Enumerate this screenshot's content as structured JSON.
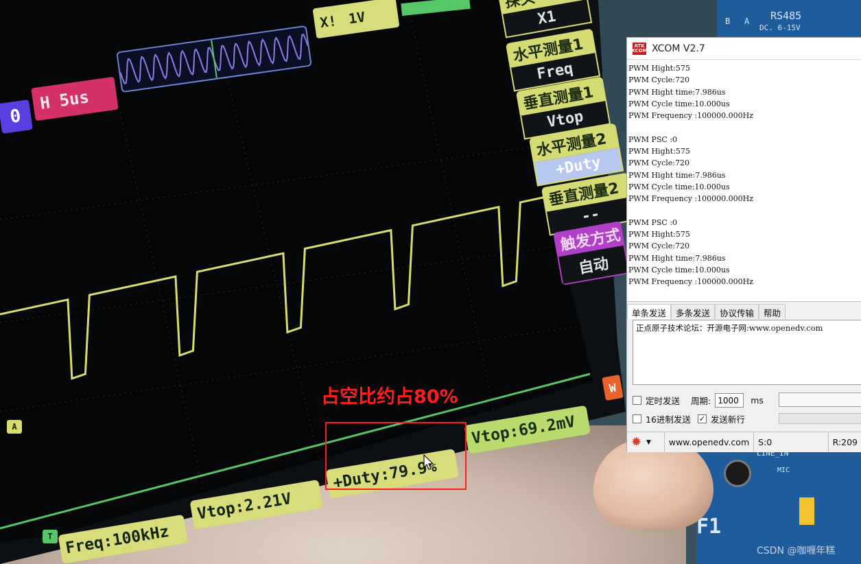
{
  "scope": {
    "timebase": {
      "channel_badge": "0",
      "h_label": "H",
      "h_value": "5us"
    },
    "probe": {
      "x_label": "X!",
      "x_value": "1V"
    },
    "side_menu": [
      {
        "label": "探头",
        "value": "X1"
      },
      {
        "label": "水平测量1",
        "value": "Freq"
      },
      {
        "label": "垂直测量1",
        "value": "Vtop"
      },
      {
        "label": "水平测量2",
        "value": "+Duty"
      },
      {
        "label": "垂直测量2",
        "value": "--"
      },
      {
        "label": "触发方式",
        "value": "自动"
      }
    ],
    "trigger_marker": "A",
    "time_marker": "T",
    "right_edge_badge": "W",
    "measurements": {
      "freq": "Freq:100kHz",
      "vtop1": "Vtop:2.21V",
      "duty": "+Duty:79.9%",
      "vtop2": "Vtop:69.2mV"
    },
    "waveform_duty_percent": 79.9,
    "waveform_color": "#d9dc6e",
    "reference_color": "#8c7de8"
  },
  "annotation": {
    "text": "占空比约占80%",
    "color": "#ff1d1d"
  },
  "board": {
    "rs485_label": "RS485",
    "voltage_label": "DC. 6-15V",
    "pin_a": "A",
    "pin_b": "B",
    "line_in": "LINE_IN",
    "mic": "MIC",
    "f1": "F1"
  },
  "xcom": {
    "logo": "ATK XCOM",
    "title": "XCOM V2.7",
    "receive_lines": [
      "PWM Hight:575",
      "PWM Cycle:720",
      "PWM Hight time:7.986us",
      "PWM Cycle time:10.000us",
      "PWM Frequency :100000.000Hz",
      "",
      "PWM PSC  :0",
      "PWM Hight:575",
      "PWM Cycle:720",
      "PWM Hight time:7.986us",
      "PWM Cycle time:10.000us",
      "PWM Frequency :100000.000Hz",
      "",
      "PWM PSC  :0",
      "PWM Hight:575",
      "PWM Cycle:720",
      "PWM Hight time:7.986us",
      "PWM Cycle time:10.000us",
      "PWM Frequency :100000.000Hz"
    ],
    "tabs": [
      "单条发送",
      "多条发送",
      "协议传输",
      "帮助"
    ],
    "send_text": "正点原子技术论坛：开源电子网:www.openedv.com",
    "timed_send_label": "定时发送",
    "period_label": "周期:",
    "period_value": "1000",
    "period_unit": "ms",
    "hex_send_label": "16进制发送",
    "newline_label": "发送新行",
    "newline_checked": "✓",
    "status_url": "www.openedv.com",
    "status_s": "S:0",
    "status_r": "R:209"
  },
  "watermark": "CSDN @咖喱年糕"
}
